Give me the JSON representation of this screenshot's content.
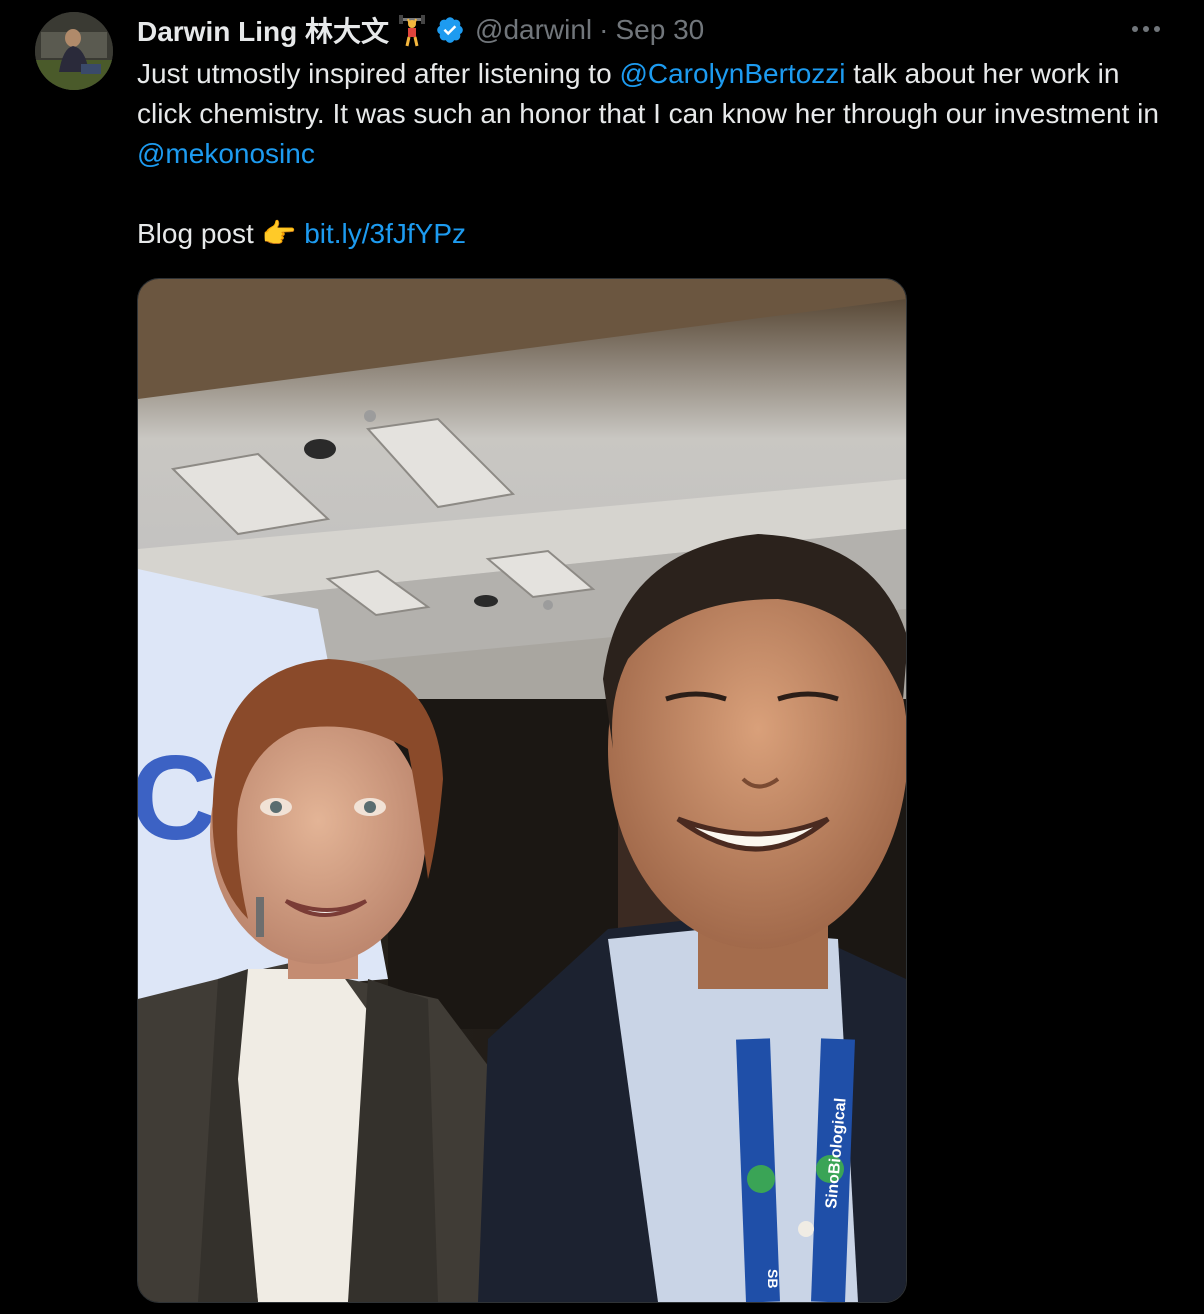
{
  "author": {
    "name": "Darwin Ling 林大文",
    "handle": "@darwinl",
    "separator": "·",
    "date": "Sep 30",
    "emoji": "weightlifter-emoji",
    "verified_icon": "verified-badge-icon"
  },
  "tweet": {
    "text_part1": "Just utmostly inspired after listening to ",
    "mention1": "@CarolynBertozzi",
    "text_part2": "  talk about her work in click chemistry.  It was such an honor that I can know her through our investment in ",
    "mention2": "@mekonosinc",
    "blog_label": "Blog post ",
    "blog_emoji": "👉",
    "blog_link": "bit.ly/3fJfYPz"
  },
  "media": {
    "screen_text": "C",
    "lanyard_text": "SinoBiological",
    "lanyard_badge": "SB"
  },
  "colors": {
    "background": "#000000",
    "text": "#e7e9ea",
    "muted": "#71767b",
    "link": "#1d9bf0"
  }
}
